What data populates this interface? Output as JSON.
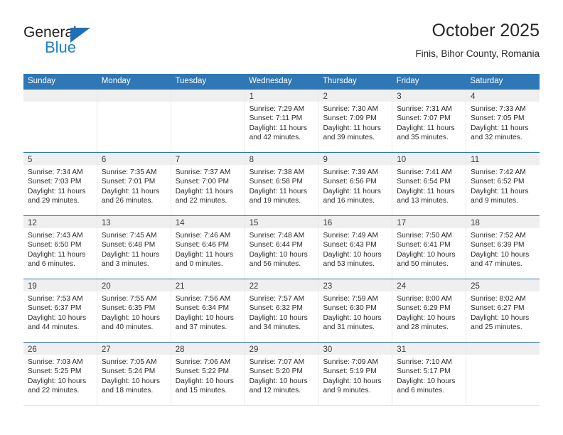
{
  "logo": {
    "word_one": "General",
    "word_two": "Blue",
    "triangle_icon": "logo-triangle-icon",
    "brand_blue": "#1f7fc4",
    "brand_dark": "#231f20"
  },
  "header": {
    "title": "October 2025",
    "subtitle": "Finis, Bihor County, Romania"
  },
  "colors": {
    "header_bar": "#2f77b5",
    "daynum_band": "#efefef",
    "cell_border": "#e8e8e8",
    "text": "#2b2b2b"
  },
  "calendar": {
    "weekday_headers": [
      "Sunday",
      "Monday",
      "Tuesday",
      "Wednesday",
      "Thursday",
      "Friday",
      "Saturday"
    ],
    "weeks": [
      [
        {
          "day": "",
          "lines": []
        },
        {
          "day": "",
          "lines": []
        },
        {
          "day": "",
          "lines": []
        },
        {
          "day": "1",
          "lines": [
            "Sunrise: 7:29 AM",
            "Sunset: 7:11 PM",
            "Daylight: 11 hours",
            "and 42 minutes."
          ]
        },
        {
          "day": "2",
          "lines": [
            "Sunrise: 7:30 AM",
            "Sunset: 7:09 PM",
            "Daylight: 11 hours",
            "and 39 minutes."
          ]
        },
        {
          "day": "3",
          "lines": [
            "Sunrise: 7:31 AM",
            "Sunset: 7:07 PM",
            "Daylight: 11 hours",
            "and 35 minutes."
          ]
        },
        {
          "day": "4",
          "lines": [
            "Sunrise: 7:33 AM",
            "Sunset: 7:05 PM",
            "Daylight: 11 hours",
            "and 32 minutes."
          ]
        }
      ],
      [
        {
          "day": "5",
          "lines": [
            "Sunrise: 7:34 AM",
            "Sunset: 7:03 PM",
            "Daylight: 11 hours",
            "and 29 minutes."
          ]
        },
        {
          "day": "6",
          "lines": [
            "Sunrise: 7:35 AM",
            "Sunset: 7:01 PM",
            "Daylight: 11 hours",
            "and 26 minutes."
          ]
        },
        {
          "day": "7",
          "lines": [
            "Sunrise: 7:37 AM",
            "Sunset: 7:00 PM",
            "Daylight: 11 hours",
            "and 22 minutes."
          ]
        },
        {
          "day": "8",
          "lines": [
            "Sunrise: 7:38 AM",
            "Sunset: 6:58 PM",
            "Daylight: 11 hours",
            "and 19 minutes."
          ]
        },
        {
          "day": "9",
          "lines": [
            "Sunrise: 7:39 AM",
            "Sunset: 6:56 PM",
            "Daylight: 11 hours",
            "and 16 minutes."
          ]
        },
        {
          "day": "10",
          "lines": [
            "Sunrise: 7:41 AM",
            "Sunset: 6:54 PM",
            "Daylight: 11 hours",
            "and 13 minutes."
          ]
        },
        {
          "day": "11",
          "lines": [
            "Sunrise: 7:42 AM",
            "Sunset: 6:52 PM",
            "Daylight: 11 hours",
            "and 9 minutes."
          ]
        }
      ],
      [
        {
          "day": "12",
          "lines": [
            "Sunrise: 7:43 AM",
            "Sunset: 6:50 PM",
            "Daylight: 11 hours",
            "and 6 minutes."
          ]
        },
        {
          "day": "13",
          "lines": [
            "Sunrise: 7:45 AM",
            "Sunset: 6:48 PM",
            "Daylight: 11 hours",
            "and 3 minutes."
          ]
        },
        {
          "day": "14",
          "lines": [
            "Sunrise: 7:46 AM",
            "Sunset: 6:46 PM",
            "Daylight: 11 hours",
            "and 0 minutes."
          ]
        },
        {
          "day": "15",
          "lines": [
            "Sunrise: 7:48 AM",
            "Sunset: 6:44 PM",
            "Daylight: 10 hours",
            "and 56 minutes."
          ]
        },
        {
          "day": "16",
          "lines": [
            "Sunrise: 7:49 AM",
            "Sunset: 6:43 PM",
            "Daylight: 10 hours",
            "and 53 minutes."
          ]
        },
        {
          "day": "17",
          "lines": [
            "Sunrise: 7:50 AM",
            "Sunset: 6:41 PM",
            "Daylight: 10 hours",
            "and 50 minutes."
          ]
        },
        {
          "day": "18",
          "lines": [
            "Sunrise: 7:52 AM",
            "Sunset: 6:39 PM",
            "Daylight: 10 hours",
            "and 47 minutes."
          ]
        }
      ],
      [
        {
          "day": "19",
          "lines": [
            "Sunrise: 7:53 AM",
            "Sunset: 6:37 PM",
            "Daylight: 10 hours",
            "and 44 minutes."
          ]
        },
        {
          "day": "20",
          "lines": [
            "Sunrise: 7:55 AM",
            "Sunset: 6:35 PM",
            "Daylight: 10 hours",
            "and 40 minutes."
          ]
        },
        {
          "day": "21",
          "lines": [
            "Sunrise: 7:56 AM",
            "Sunset: 6:34 PM",
            "Daylight: 10 hours",
            "and 37 minutes."
          ]
        },
        {
          "day": "22",
          "lines": [
            "Sunrise: 7:57 AM",
            "Sunset: 6:32 PM",
            "Daylight: 10 hours",
            "and 34 minutes."
          ]
        },
        {
          "day": "23",
          "lines": [
            "Sunrise: 7:59 AM",
            "Sunset: 6:30 PM",
            "Daylight: 10 hours",
            "and 31 minutes."
          ]
        },
        {
          "day": "24",
          "lines": [
            "Sunrise: 8:00 AM",
            "Sunset: 6:29 PM",
            "Daylight: 10 hours",
            "and 28 minutes."
          ]
        },
        {
          "day": "25",
          "lines": [
            "Sunrise: 8:02 AM",
            "Sunset: 6:27 PM",
            "Daylight: 10 hours",
            "and 25 minutes."
          ]
        }
      ],
      [
        {
          "day": "26",
          "lines": [
            "Sunrise: 7:03 AM",
            "Sunset: 5:25 PM",
            "Daylight: 10 hours",
            "and 22 minutes."
          ]
        },
        {
          "day": "27",
          "lines": [
            "Sunrise: 7:05 AM",
            "Sunset: 5:24 PM",
            "Daylight: 10 hours",
            "and 18 minutes."
          ]
        },
        {
          "day": "28",
          "lines": [
            "Sunrise: 7:06 AM",
            "Sunset: 5:22 PM",
            "Daylight: 10 hours",
            "and 15 minutes."
          ]
        },
        {
          "day": "29",
          "lines": [
            "Sunrise: 7:07 AM",
            "Sunset: 5:20 PM",
            "Daylight: 10 hours",
            "and 12 minutes."
          ]
        },
        {
          "day": "30",
          "lines": [
            "Sunrise: 7:09 AM",
            "Sunset: 5:19 PM",
            "Daylight: 10 hours",
            "and 9 minutes."
          ]
        },
        {
          "day": "31",
          "lines": [
            "Sunrise: 7:10 AM",
            "Sunset: 5:17 PM",
            "Daylight: 10 hours",
            "and 6 minutes."
          ]
        },
        {
          "day": "",
          "lines": []
        }
      ]
    ]
  }
}
